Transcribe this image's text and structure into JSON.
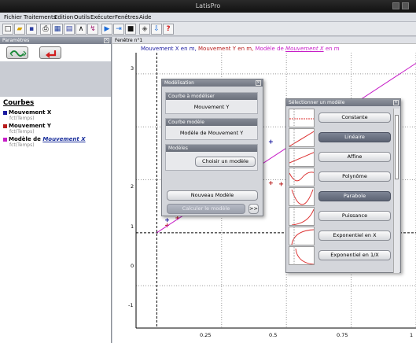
{
  "window": {
    "title": "LatisPro"
  },
  "menu": [
    "Fichier",
    "Traitements",
    "Edition",
    "Outils",
    "Exécuter",
    "Fenêtres",
    "Aide"
  ],
  "toolbar_icons": [
    "new-file-icon",
    "open-folder-icon",
    "save-icon",
    "print-icon",
    "table-icon",
    "curve-icon",
    "tools-icon",
    "play-icon",
    "step-icon",
    "stop-icon",
    "modelisation-icon",
    "export-icon",
    "help-icon"
  ],
  "left_panel": {
    "header": "Paramètres",
    "section_title": "Courbes",
    "curves": [
      {
        "name": "Mouvement X",
        "sub": "fct(Temps)",
        "color": "#1a1aa0"
      },
      {
        "name": "Mouvement Y",
        "sub": "fct(Temps)",
        "color": "#b81c1c"
      },
      {
        "name_prefix": "Modèle de ",
        "name_link": "Mouvement X",
        "sub": "fct(Temps)",
        "color": "#c71ec7"
      }
    ]
  },
  "graph": {
    "window_title": "Fenêtre n°1",
    "legend": {
      "x": "Mouvement X en m,",
      "y": "Mouvement Y en m,",
      "model_prefix": "Modèle de ",
      "model_link": "Mouvement X",
      "model_suffix": " en m"
    },
    "y_ticks": [
      "3",
      "2",
      "1",
      "0",
      "-1"
    ],
    "x_ticks": [
      "0.25",
      "0.5",
      "0.75",
      "1"
    ]
  },
  "chart_data": {
    "type": "scatter",
    "xlim": [
      -0.08,
      1.0
    ],
    "ylim": [
      -1.8,
      3.4
    ],
    "grid": true,
    "series": [
      {
        "name": "Mouvement X",
        "color": "#1a1aa0",
        "marker": "+",
        "x": [
          0.04,
          0.08,
          0.12,
          0.16,
          0.2,
          0.24,
          0.28,
          0.32,
          0.36,
          0.4,
          0.44
        ],
        "y": [
          0.24,
          0.36,
          0.52,
          0.68,
          0.82,
          0.98,
          1.12,
          1.28,
          1.42,
          1.58,
          1.72
        ]
      },
      {
        "name": "Mouvement Y",
        "color": "#b81c1c",
        "marker": "+",
        "x": [
          0.04,
          0.08,
          0.12,
          0.16,
          0.2,
          0.24,
          0.28,
          0.32,
          0.36,
          0.4,
          0.44,
          0.48,
          0.52
        ],
        "y": [
          0.14,
          0.28,
          0.42,
          0.54,
          0.64,
          0.74,
          0.82,
          0.88,
          0.92,
          0.94,
          0.94,
          0.92,
          0.9
        ]
      },
      {
        "name": "Modèle de Mouvement X",
        "color": "#c71ec7",
        "type": "line",
        "x": [
          0.0,
          1.0
        ],
        "y": [
          0.0,
          3.2
        ]
      }
    ]
  },
  "modelisation": {
    "title": "Modélisation",
    "groups": [
      {
        "header": "Courbe à modéliser",
        "value": "Mouvement Y"
      },
      {
        "header": "Courbe modèle",
        "value": "Modèle de Mouvement Y"
      },
      {
        "header": "Modèles",
        "button": "Choisir un modèle"
      }
    ],
    "new_model_button": "Nouveau Modèle",
    "compute_button": "Calculer le modèle",
    "more_button": ">>"
  },
  "model_selector": {
    "title": "Sélectionner un modèle",
    "selected": "Parabole",
    "models": [
      "Constante",
      "Linéaire",
      "Affine",
      "Polynôme",
      "Parabole",
      "Puissance",
      "Exponentiel en X",
      "Exponentiel en 1/X"
    ],
    "highlighted": [
      "Linéaire",
      "Parabole"
    ]
  }
}
